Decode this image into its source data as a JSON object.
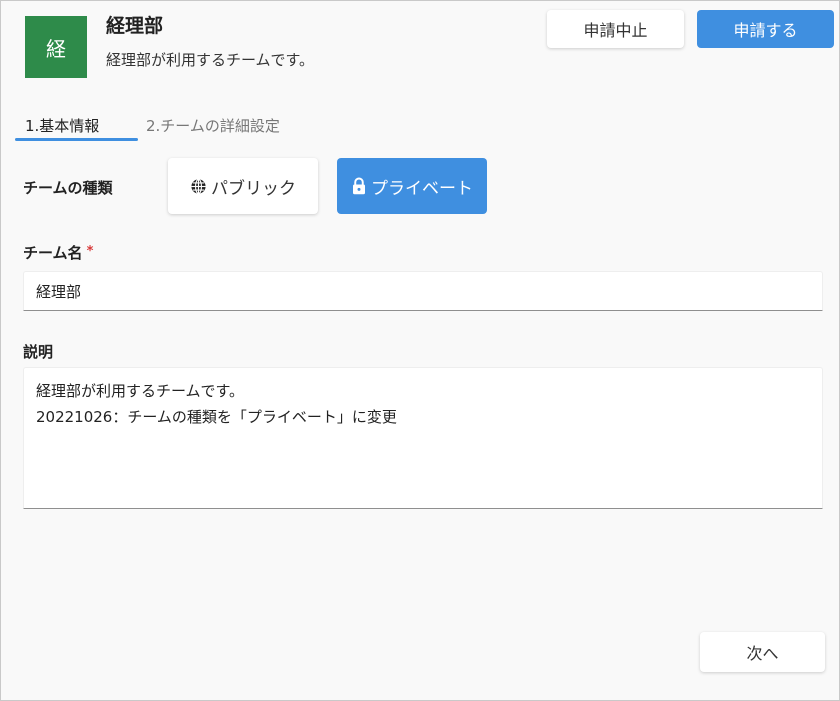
{
  "header": {
    "avatar_text": "経",
    "title": "経理部",
    "subtitle": "経理部が利用するチームです。",
    "cancel_label": "申請中止",
    "submit_label": "申請する"
  },
  "tabs": [
    {
      "label": "1.基本情報",
      "active": true
    },
    {
      "label": "2.チームの詳細設定",
      "active": false
    }
  ],
  "form": {
    "team_type": {
      "label": "チームの種類",
      "options": [
        {
          "label": "パブリック",
          "icon": "globe-icon",
          "selected": false
        },
        {
          "label": "プライベート",
          "icon": "lock-icon",
          "selected": true
        }
      ]
    },
    "team_name": {
      "label": "チーム名",
      "required_mark": "*",
      "value": "経理部"
    },
    "description": {
      "label": "説明",
      "lines": [
        "経理部が利用するチームです。",
        "20221026：チームの種類を「プライベート」に変更"
      ]
    }
  },
  "footer": {
    "next_label": "次へ"
  },
  "colors": {
    "accent": "#3f8fe0",
    "avatar": "#2e8b4a",
    "required": "#d83a3a"
  }
}
